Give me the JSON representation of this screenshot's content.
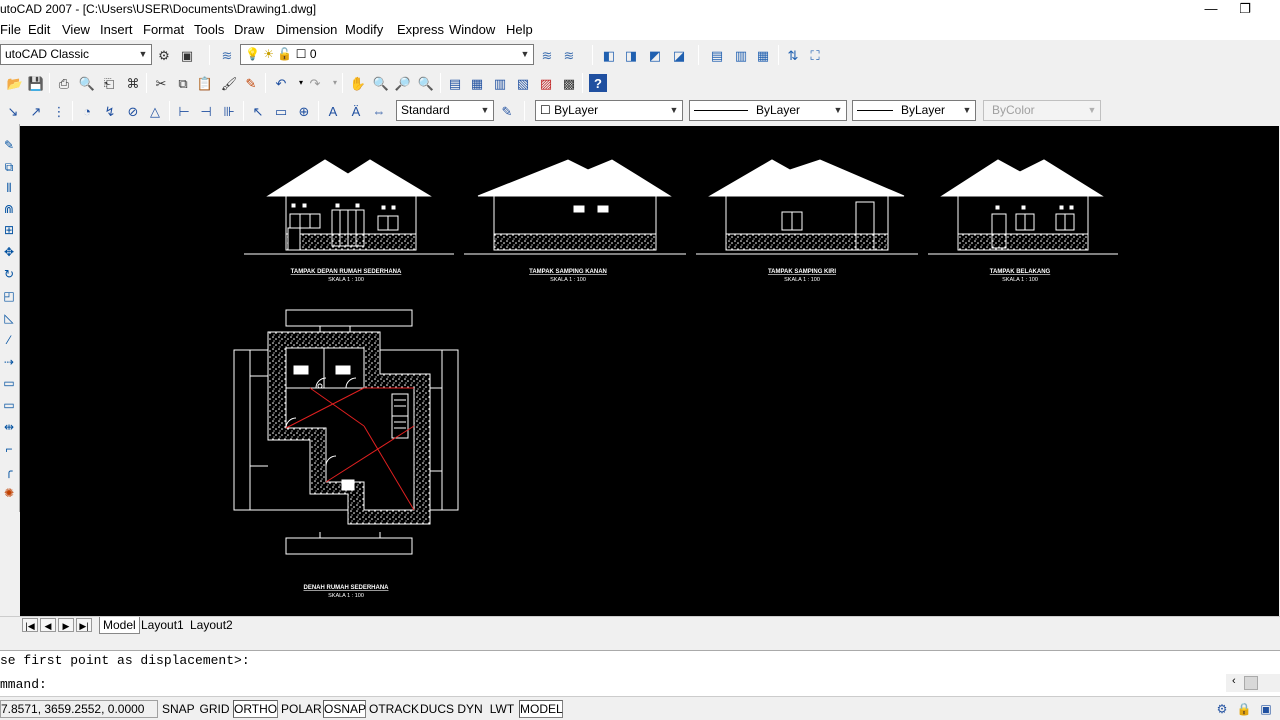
{
  "window": {
    "title": "utoCAD 2007 - [C:\\Users\\USER\\Documents\\Drawing1.dwg]",
    "minimize": "—",
    "restore": "❐"
  },
  "menu": [
    "File",
    "Edit",
    "View",
    "Insert",
    "Format",
    "Tools",
    "Draw",
    "Dimension",
    "Modify",
    "Express",
    "Window",
    "Help"
  ],
  "toolbar2": {
    "workspace": "utoCAD Classic",
    "layer": "0"
  },
  "properties": {
    "text_style": "Standard",
    "color": "ByLayer",
    "linetype": "ByLayer",
    "lineweight": "ByLayer",
    "plotstyle": "ByColor"
  },
  "drawing": {
    "elevations": [
      {
        "title": "TAMPAK DEPAN RUMAH SEDERHANA",
        "scale": "SKALA 1 : 100"
      },
      {
        "title": "TAMPAK SAMPING KANAN",
        "scale": "SKALA 1 : 100"
      },
      {
        "title": "TAMPAK SAMPING KIRI",
        "scale": "SKALA 1 : 100"
      },
      {
        "title": "TAMPAK BELAKANG",
        "scale": "SKALA 1 : 100"
      }
    ],
    "plan": {
      "title": "DENAH RUMAH SEDERHANA",
      "scale": "SKALA 1 : 100"
    },
    "colors": {
      "background": "#000000",
      "lines": "#ffffff",
      "red": "#e02020"
    }
  },
  "tabs": {
    "nav": [
      "|◀",
      "◀",
      "▶",
      "▶|"
    ],
    "items": [
      "Model",
      "Layout1",
      "Layout2"
    ],
    "active": "Model"
  },
  "command": {
    "history": "se first point as displacement>:",
    "prompt": "mmand:"
  },
  "status": {
    "coords": "7.8571, 3659.2552, 0.0000",
    "buttons": [
      {
        "label": "SNAP",
        "on": false
      },
      {
        "label": "GRID",
        "on": false
      },
      {
        "label": "ORTHO",
        "on": true
      },
      {
        "label": "POLAR",
        "on": false
      },
      {
        "label": "OSNAP",
        "on": true
      },
      {
        "label": "OTRACK",
        "on": false
      },
      {
        "label": "DUCS",
        "on": false
      },
      {
        "label": "DYN",
        "on": false
      },
      {
        "label": "LWT",
        "on": false
      },
      {
        "label": "MODEL",
        "on": true
      }
    ]
  }
}
